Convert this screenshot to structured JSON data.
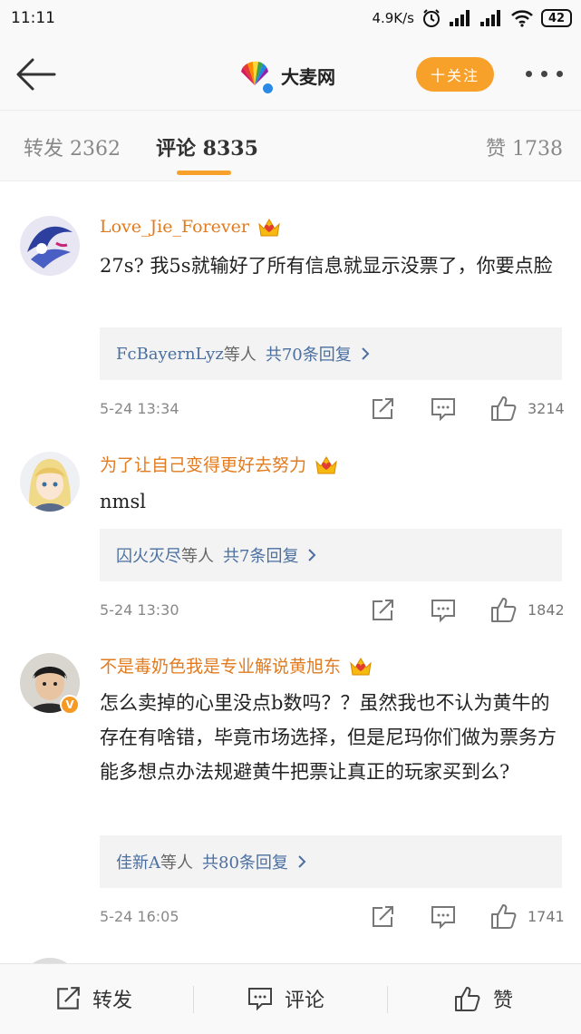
{
  "status_bar": {
    "time": "11:11",
    "network_speed": "4.9K/s",
    "battery": "42"
  },
  "header": {
    "account_name": "大麦网",
    "follow_label": "十关注"
  },
  "tabs": [
    {
      "label": "转发 2362"
    },
    {
      "label": "评论 8335"
    },
    {
      "label": "赞 1738"
    }
  ],
  "comments": [
    {
      "username": "Love_Jie_Forever",
      "text": "27s? 我5s就输好了所有信息就显示没票了，你要点脸",
      "replies": {
        "users": "FcBayernLyz",
        "suffix": "等人",
        "count": "共70条回复"
      },
      "time": "5-24 13:34",
      "likes": "3214"
    },
    {
      "username": "为了让自己变得更好去努力",
      "text": "nmsl",
      "replies": {
        "users": "囚火灭尽",
        "suffix": "等人",
        "count": "共7条回复"
      },
      "time": "5-24 13:30",
      "likes": "1842"
    },
    {
      "username": "不是毒奶色我是专业解说黄旭东",
      "avatar_badge": "V",
      "text": "怎么卖掉的心里没点b数吗？？虽然我也不认为黄牛的存在有啥错，毕竟市场选择，但是尼玛你们做为票务方能多想点办法规避黄牛把票让真正的玩家买到么?",
      "replies": {
        "users": "佳新A",
        "suffix": "等人",
        "count": "共80条回复"
      },
      "time": "5-24 16:05",
      "likes": "1741"
    }
  ],
  "bottom_bar": {
    "repost": "转发",
    "comment": "评论",
    "like": "赞"
  }
}
